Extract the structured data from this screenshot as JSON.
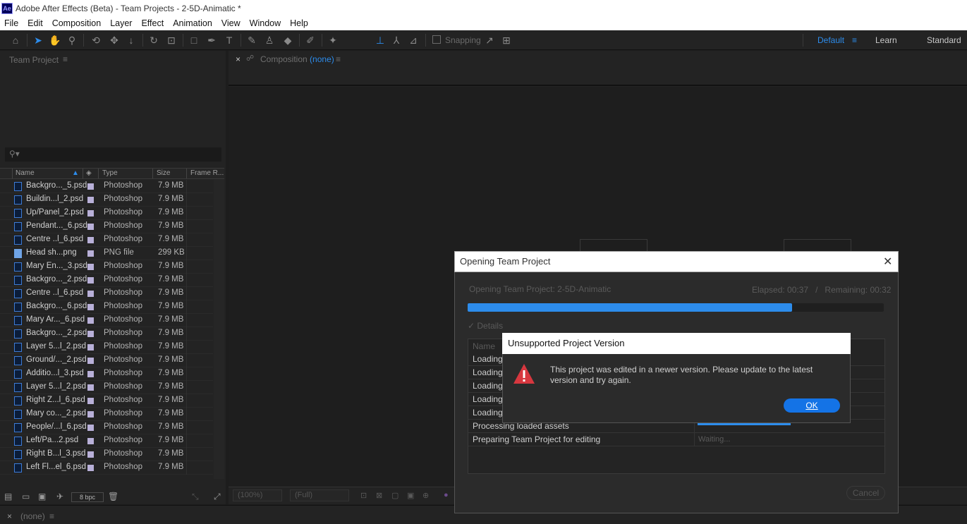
{
  "window": {
    "logo": "Ae",
    "title": "Adobe After Effects (Beta) - Team Projects - 2-5D-Animatic *"
  },
  "menu": [
    "File",
    "Edit",
    "Composition",
    "Layer",
    "Effect",
    "Animation",
    "View",
    "Window",
    "Help"
  ],
  "toolbar": {
    "snapping_label": "Snapping",
    "workspaces": [
      "Default",
      "Learn",
      "Standard"
    ],
    "workspace_menu_icon": "≡"
  },
  "project_panel": {
    "tab_label": "Team Project",
    "menu_icon": "≡",
    "search_icon": "⚲▾",
    "columns": [
      "Name",
      "Type",
      "Size",
      "Frame R..."
    ],
    "rows": [
      {
        "name": "Backgro..._5.psd",
        "type": "Photoshop",
        "size": "7.9 MB",
        "kind": "psd"
      },
      {
        "name": "Buildin...l_2.psd",
        "type": "Photoshop",
        "size": "7.9 MB",
        "kind": "psd"
      },
      {
        "name": "Up/Panel_2.psd",
        "type": "Photoshop",
        "size": "7.9 MB",
        "kind": "psd"
      },
      {
        "name": "Pendant..._6.psd",
        "type": "Photoshop",
        "size": "7.9 MB",
        "kind": "psd"
      },
      {
        "name": "Centre ..l_6.psd",
        "type": "Photoshop",
        "size": "7.9 MB",
        "kind": "psd"
      },
      {
        "name": "Head sh...png",
        "type": "PNG file",
        "size": "299 KB",
        "kind": "png"
      },
      {
        "name": "Mary En..._3.psd",
        "type": "Photoshop",
        "size": "7.9 MB",
        "kind": "psd"
      },
      {
        "name": "Backgro..._2.psd",
        "type": "Photoshop",
        "size": "7.9 MB",
        "kind": "psd"
      },
      {
        "name": "Centre ..l_6.psd",
        "type": "Photoshop",
        "size": "7.9 MB",
        "kind": "psd"
      },
      {
        "name": "Backgro..._6.psd",
        "type": "Photoshop",
        "size": "7.9 MB",
        "kind": "psd"
      },
      {
        "name": "Mary Ar..._6.psd",
        "type": "Photoshop",
        "size": "7.9 MB",
        "kind": "psd"
      },
      {
        "name": "Backgro..._2.psd",
        "type": "Photoshop",
        "size": "7.9 MB",
        "kind": "psd"
      },
      {
        "name": "Layer 5...l_2.psd",
        "type": "Photoshop",
        "size": "7.9 MB",
        "kind": "psd"
      },
      {
        "name": "Ground/..._2.psd",
        "type": "Photoshop",
        "size": "7.9 MB",
        "kind": "psd"
      },
      {
        "name": "Additio...l_3.psd",
        "type": "Photoshop",
        "size": "7.9 MB",
        "kind": "psd"
      },
      {
        "name": "Layer 5...l_2.psd",
        "type": "Photoshop",
        "size": "7.9 MB",
        "kind": "psd"
      },
      {
        "name": "Right Z...l_6.psd",
        "type": "Photoshop",
        "size": "7.9 MB",
        "kind": "psd"
      },
      {
        "name": "Mary co..._2.psd",
        "type": "Photoshop",
        "size": "7.9 MB",
        "kind": "psd"
      },
      {
        "name": "People/...l_6.psd",
        "type": "Photoshop",
        "size": "7.9 MB",
        "kind": "psd"
      },
      {
        "name": "Left/Pa...2.psd",
        "type": "Photoshop",
        "size": "7.9 MB",
        "kind": "psd"
      },
      {
        "name": "Right B...l_3.psd",
        "type": "Photoshop",
        "size": "7.9 MB",
        "kind": "psd"
      },
      {
        "name": "Left Fl...el_6.psd",
        "type": "Photoshop",
        "size": "7.9 MB",
        "kind": "psd"
      }
    ],
    "bpc_label": "8 bpc"
  },
  "composition_panel": {
    "close": "×",
    "lock_icon": "🔒",
    "title_prefix": "Composition",
    "title_value": "(none)",
    "menu_icon": "≡",
    "zoom": "(100%)",
    "resolution": "(Full)"
  },
  "timeline": {
    "close": "×",
    "label": "(none)",
    "menu_icon": "≡"
  },
  "opening_dialog": {
    "title": "Opening Team Project",
    "close": "✕",
    "status": "Opening Team Project: 2-5D-Animatic",
    "elapsed": "Elapsed: 00:37",
    "remaining": "Remaining: 00:32",
    "progress": 0.78,
    "details_label": "✓  Details",
    "name_header": "Name",
    "rows": [
      {
        "name": "Loading",
        "status": "",
        "progress": 0
      },
      {
        "name": "Loading",
        "status": "",
        "progress": 0
      },
      {
        "name": "Loading",
        "status": "",
        "progress": 0
      },
      {
        "name": "Loading",
        "status": "",
        "progress": 0
      },
      {
        "name": "Loading",
        "status": "",
        "progress": 0
      },
      {
        "name": "Processing loaded assets",
        "status": "",
        "progress": 0.5
      },
      {
        "name": "Preparing Team Project for editing",
        "status": "Waiting...",
        "progress": 0
      }
    ],
    "cancel_label": "Cancel"
  },
  "error_dialog": {
    "title": "Unsupported Project Version",
    "icon": "warning-icon",
    "message": "This project was edited in a newer version. Please update to the latest version and try again.",
    "ok_label": "OK"
  },
  "colors": {
    "accent": "#2d8ceb",
    "ok_button": "#1473e6",
    "warning": "#d7373f",
    "label_lavender": "#b8b0d8"
  }
}
